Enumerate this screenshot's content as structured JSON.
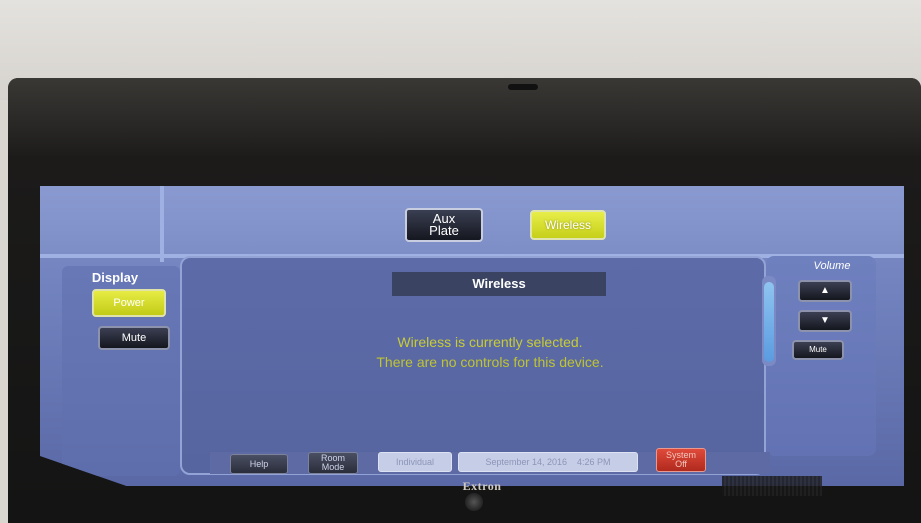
{
  "nav": {
    "aux_plate_line1": "Aux",
    "aux_plate_line2": "Plate",
    "wireless": "Wireless"
  },
  "display_panel": {
    "title": "Display",
    "power": "Power",
    "mute": "Mute"
  },
  "main": {
    "title": "Wireless",
    "message_line1": "Wireless is currently selected.",
    "message_line2": "There are no controls for this device."
  },
  "volume_panel": {
    "title": "Volume",
    "up_icon": "triangle-up-icon",
    "down_icon": "triangle-down-icon",
    "mute": "Mute"
  },
  "bottom_bar": {
    "help": "Help",
    "room_mode_line1": "Room",
    "room_mode_line2": "Mode",
    "individual": "Individual",
    "date": "September 14, 2016",
    "time": "4:26 PM",
    "system_off_line1": "System",
    "system_off_line2": "Off"
  },
  "device": {
    "brand": "Extron"
  },
  "colors": {
    "accent_yellow": "#d4dc2a",
    "screen_blue": "#6f80bd",
    "alert_red": "#c8382a"
  }
}
